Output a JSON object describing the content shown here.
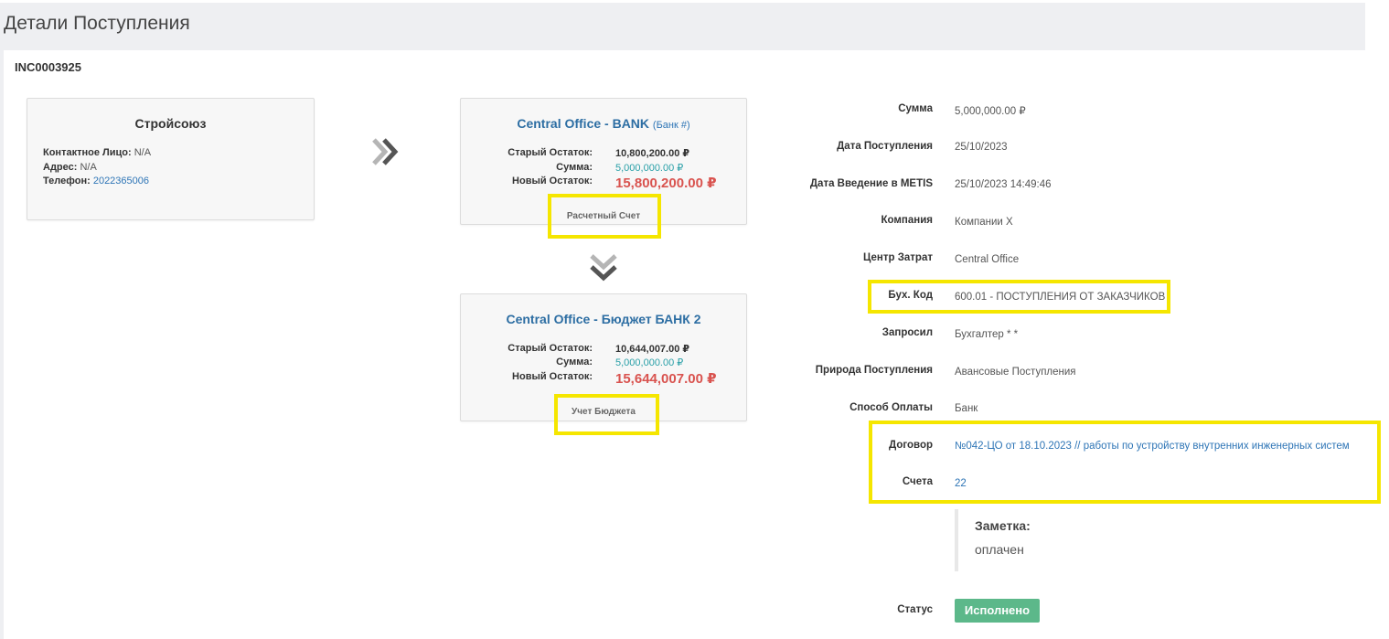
{
  "page": {
    "title": "Детали Поступления",
    "reference": "INC0003925"
  },
  "vendor": {
    "name": "Стройсоюз",
    "contact_label": "Контактное Лицо:",
    "contact_value": "N/A",
    "address_label": "Адрес:",
    "address_value": "N/A",
    "phone_label": "Телефон:",
    "phone_value": "2022365006"
  },
  "bank_account": {
    "title": "Central Office - BANK",
    "title_suffix": "(Банк #)",
    "old_balance_label": "Старый Остаток:",
    "old_balance": "10,800,200.00 ₽",
    "amount_label": "Сумма:",
    "amount": "5,000,000.00 ₽",
    "new_balance_label": "Новый Остаток:",
    "new_balance": "15,800,200.00 ₽",
    "tag": "Расчетный Счет"
  },
  "budget_account": {
    "title": "Central Office - Бюджет БАНК 2",
    "old_balance_label": "Старый Остаток:",
    "old_balance": "10,644,007.00 ₽",
    "amount_label": "Сумма:",
    "amount": "5,000,000.00 ₽",
    "new_balance_label": "Новый Остаток:",
    "new_balance": "15,644,007.00 ₽",
    "tag": "Учет Бюджета"
  },
  "details": [
    {
      "label": "Сумма",
      "value": "5,000,000.00 ₽"
    },
    {
      "label": "Дата Поступления",
      "value": "25/10/2023"
    },
    {
      "label": "Дата Введение в METIS",
      "value": "25/10/2023 14:49:46"
    },
    {
      "label": "Компания",
      "value": "Компании X"
    },
    {
      "label": "Центр Затрат",
      "value": "Central Office"
    },
    {
      "label": "Бух. Код",
      "value": "600.01 - ПОСТУПЛЕНИЯ ОТ ЗАКАЗЧИКОВ"
    },
    {
      "label": "Запросил",
      "value": "Бухгалтер * *"
    },
    {
      "label": "Природа Поступления",
      "value": "Авансовые Поступления"
    },
    {
      "label": "Способ Оплаты",
      "value": "Банк"
    },
    {
      "label": "Договор",
      "value": "№042-ЦО от 18.10.2023 // работы по устройству внутренних инженерных систем"
    },
    {
      "label": "Счета",
      "value": "22"
    }
  ],
  "note": {
    "title": "Заметка:",
    "text": "оплачен"
  },
  "status": {
    "label": "Статус",
    "value": "Исполнено"
  },
  "icons": {
    "right": "double-chevron-right-icon",
    "down": "double-chevron-down-icon"
  },
  "colors": {
    "highlight": "#f5e600",
    "status": "#5cb88a",
    "link": "#2e75b6",
    "balance": "#d9534f"
  }
}
